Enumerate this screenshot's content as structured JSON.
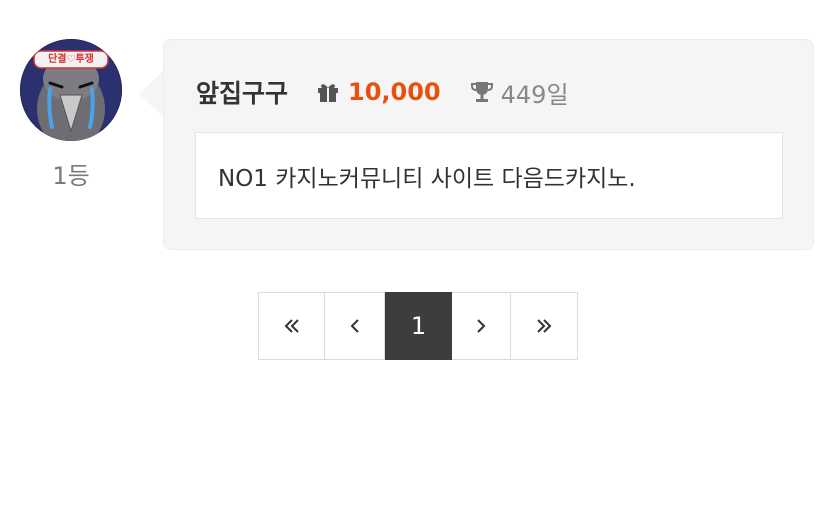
{
  "comment": {
    "rank_label": "1등",
    "nickname": "앞집구구",
    "points_icon": "gift-icon",
    "points": "10,000",
    "days_icon": "trophy-icon",
    "days": "449일",
    "content": "NO1 카지노커뮤니티 사이트 다음드카지노.",
    "avatar": {
      "banner_text": "단결♡투쟁",
      "description": "penguin-avatar"
    }
  },
  "pagination": {
    "first_icon": "double-chevron-left-icon",
    "prev_icon": "chevron-left-icon",
    "current_page": "1",
    "next_icon": "chevron-right-icon",
    "last_icon": "double-chevron-right-icon"
  },
  "colors": {
    "points": "#e8500e",
    "active_page_bg": "#3d3d3d",
    "bubble_bg": "#f5f5f5"
  }
}
